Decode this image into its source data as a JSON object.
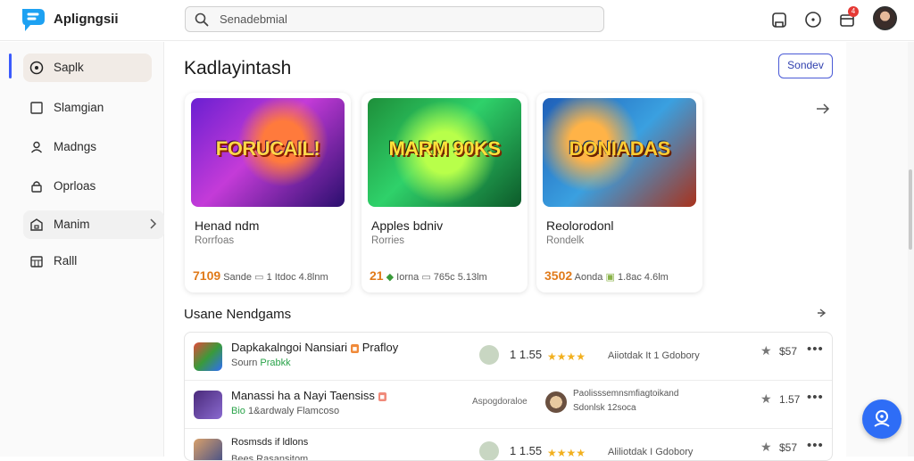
{
  "app": {
    "title": "Apligngsii"
  },
  "search": {
    "placeholder": "Senadebmial"
  },
  "notifications": {
    "count": "4"
  },
  "sidebar": {
    "items": [
      {
        "label": "Saplk",
        "icon": "play-circle-icon"
      },
      {
        "label": "Slamgian",
        "icon": "square-icon"
      },
      {
        "label": "Madngs",
        "icon": "user-icon"
      },
      {
        "label": "Oprloas",
        "icon": "lock-icon"
      },
      {
        "label": "Manim",
        "icon": "bag-icon"
      },
      {
        "label": "Ralll",
        "icon": "calendar-icon"
      }
    ]
  },
  "main": {
    "title": "Kadlayintash",
    "header_button": "Sondev",
    "cards": [
      {
        "art_text": "FORUCAIL!",
        "title": "Henad ndm",
        "subtitle": "Rorrfoas",
        "num": "7109",
        "stat1": "Sande",
        "stat2": "1 Itdoc 4.8lnm"
      },
      {
        "art_text": "MARM 90KS",
        "title": "Apples bdniv",
        "subtitle": "Rorries",
        "num": "21",
        "stat1": "Iorna",
        "stat2": "765c 5.13lm"
      },
      {
        "art_text": "DONIADAS",
        "title": "Reolorodonl",
        "subtitle": "Rondelk",
        "num": "3502",
        "stat1": "Aonda",
        "stat2": "1.8ac 4.6lm"
      }
    ],
    "section_title": "Usane Nendgams",
    "rows": [
      {
        "title": "Dapkakalngoi Nansiari",
        "tag": "Prafloy",
        "sub_a": "Sourn",
        "sub_b": "Prabkk",
        "mid_num": "1 1.55",
        "stars": "★★★★",
        "meta": "Aiiotdak It 1 Gdobory",
        "price": "$57"
      },
      {
        "title": "Manassi ha a Nayi Taensiss",
        "tag": "",
        "sub_a": "Bio",
        "sub_b": "1&ardwaly Flamcoso",
        "mid_num": "",
        "stars": "",
        "meta": "",
        "extra_label": "Aspogdoraloe",
        "extra_title": "Paolisssemnsmfiagtoikand",
        "extra_sub": "Sdonlsk 12soca",
        "price": "1.57"
      },
      {
        "title": "Rosmsds if ldlons",
        "tag": "",
        "sub_a": "Bees",
        "sub_b": "Rasansitom",
        "mid_num": "1 1.55",
        "stars": "★★★★",
        "meta": "Aliliotdak I Gdobory",
        "price": "$57"
      }
    ]
  },
  "colors": {
    "accent": "#3b5bfd",
    "fab": "#2e6df6",
    "orange": "#e07a1a",
    "green": "#2aa34a"
  }
}
